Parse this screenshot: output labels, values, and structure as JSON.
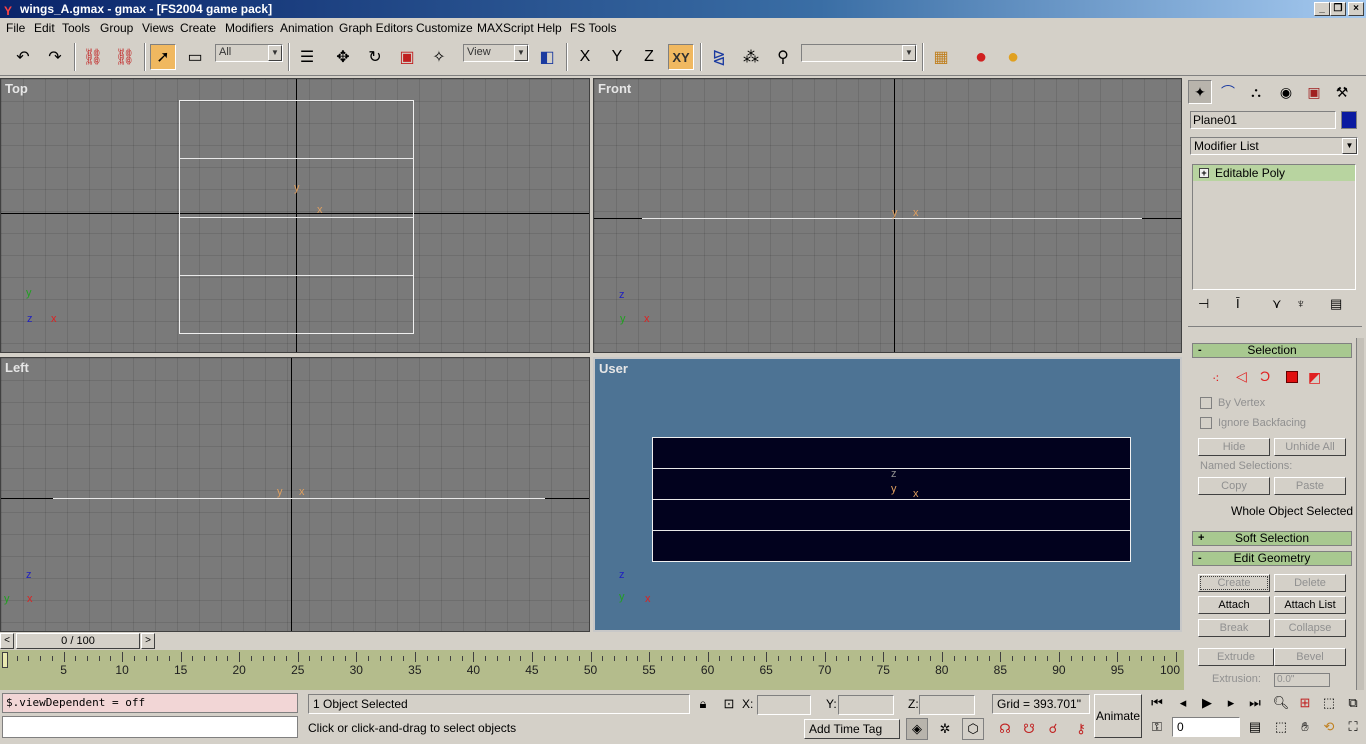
{
  "title": "wings_A.gmax - gmax - [FS2004 game pack]",
  "menu": [
    "File",
    "Edit",
    "Tools",
    "Group",
    "Views",
    "Create",
    "Modifiers",
    "Animation",
    "Graph Editors",
    "Customize",
    "MAXScript",
    "Help",
    "FS Tools"
  ],
  "toolbar": {
    "filter": "All",
    "coord": "View",
    "axes": [
      "X",
      "Y",
      "Z",
      "XY"
    ],
    "named_sel": ""
  },
  "viewports": {
    "top": "Top",
    "front": "Front",
    "left": "Left",
    "user": "User"
  },
  "gizmo": {
    "x": "x",
    "y": "y",
    "z": "z"
  },
  "panel": {
    "object_name": "Plane01",
    "object_color": "#0a1aa0",
    "modifier_list": "Modifier List",
    "stack_item": "Editable Poly",
    "stack_plus": "+",
    "selection": {
      "title": "Selection",
      "collapse": "-",
      "by_vertex": "By Vertex",
      "ignore_backfacing": "Ignore Backfacing",
      "hide": "Hide",
      "unhide_all": "Unhide All",
      "named_sel": "Named Selections:",
      "copy": "Copy",
      "paste": "Paste",
      "whole": "Whole Object Selected"
    },
    "soft_selection": {
      "title": "Soft Selection",
      "expand": "+"
    },
    "edit_geometry": {
      "title": "Edit Geometry",
      "collapse": "-",
      "create": "Create",
      "delete": "Delete",
      "attach": "Attach",
      "attach_list": "Attach List",
      "break": "Break",
      "collapse_btn": "Collapse",
      "extrude": "Extrude",
      "bevel": "Bevel",
      "extrusion": "Extrusion:",
      "extrusion_val": "0.0\""
    }
  },
  "timeline": {
    "frame": "0 / 100",
    "prev": "<",
    "next": ">",
    "ticks": [
      "5",
      "10",
      "15",
      "20",
      "25",
      "30",
      "35",
      "40",
      "45",
      "50",
      "55",
      "60",
      "65",
      "70",
      "75",
      "80",
      "85",
      "90",
      "95",
      "100"
    ]
  },
  "status": {
    "script": "$.viewDependent = off",
    "selected": "1 Object Selected",
    "prompt": "Click or click-and-drag to select objects",
    "x_label": "X:",
    "y_label": "Y:",
    "z_label": "Z:",
    "grid": "Grid = 393.701\"",
    "animate": "Animate",
    "add_time_tag": "Add Time Tag",
    "frame": "0"
  }
}
